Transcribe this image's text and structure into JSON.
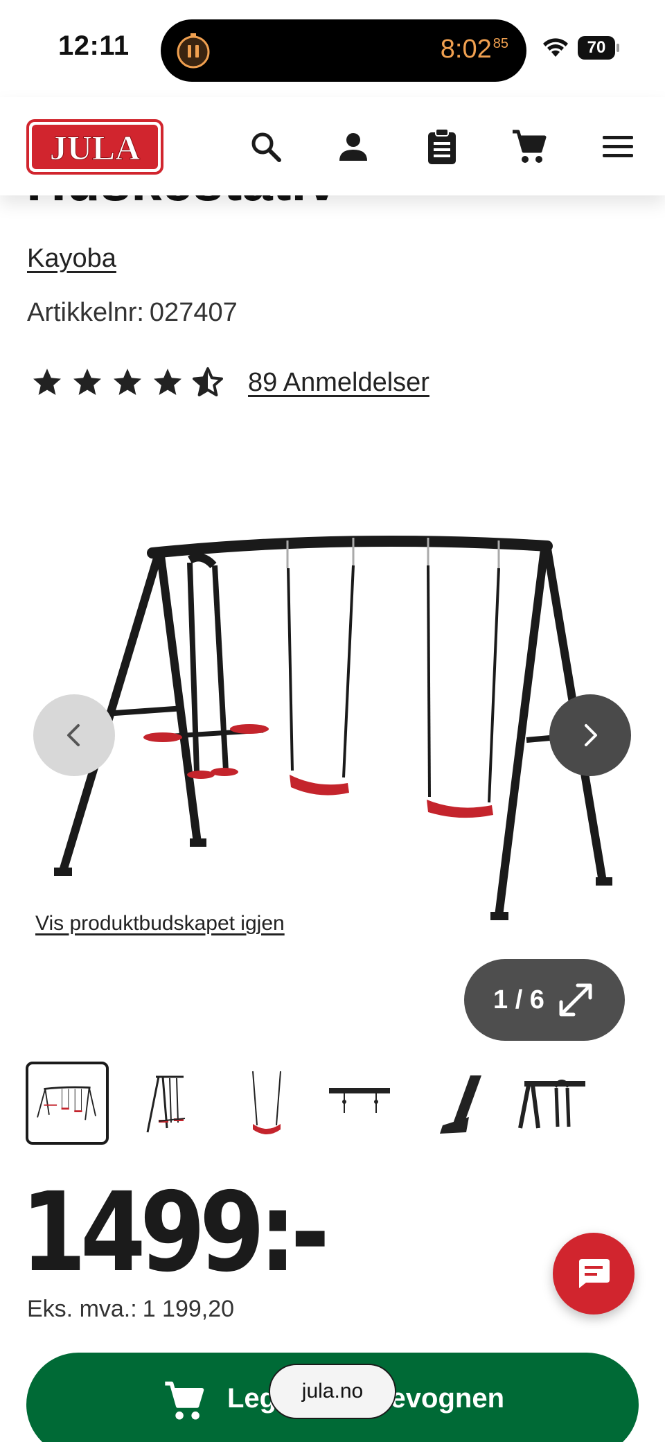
{
  "status_bar": {
    "time": "12:11",
    "timer": "8:02",
    "timer_fraction": "85",
    "battery": "70"
  },
  "header": {
    "logo_text": "JULA",
    "icons": [
      "search-icon",
      "account-icon",
      "clipboard-icon",
      "cart-icon",
      "menu-icon"
    ]
  },
  "product": {
    "title_partial": "Huskestativ",
    "brand": "Kayoba",
    "sku_label": "Artikkelnr:",
    "sku": "027407",
    "rating": 4.5,
    "reviews": "89 Anmeldelser"
  },
  "gallery": {
    "show_message_link": "Vis produktbudskapet igjen",
    "counter": "1 / 6",
    "current": 1,
    "total": 6
  },
  "pricing": {
    "price": "1499:-",
    "ex_vat_label": "Eks. mva.:",
    "ex_vat": "1 199,20"
  },
  "cart": {
    "label": "Legg i handlevognen"
  },
  "browser": {
    "url": "jula.no"
  },
  "colors": {
    "brand_red": "#d1252e",
    "cart_green": "#006a36",
    "timer_orange": "#f0a050"
  }
}
